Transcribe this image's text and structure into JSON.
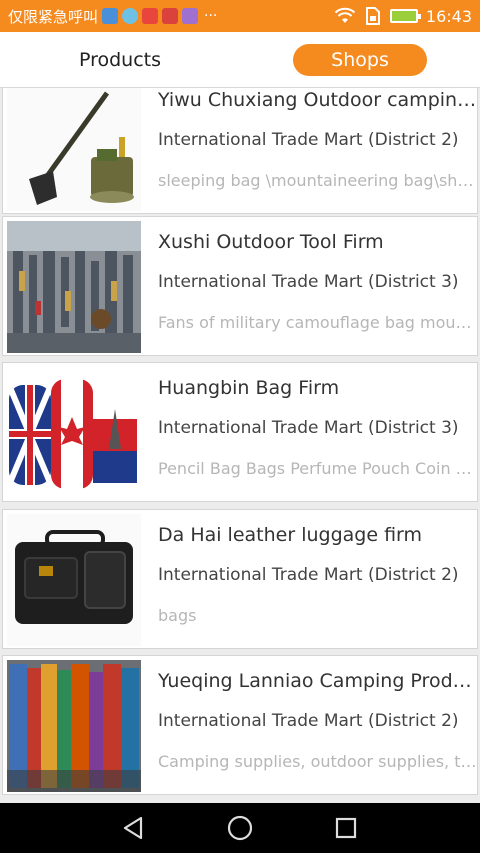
{
  "status_bar": {
    "carrier": "仅限紧急呼叫",
    "overflow": "···",
    "time": "16:43"
  },
  "tabs": {
    "products": "Products",
    "shops": "Shops",
    "active": "Shops"
  },
  "shops": [
    {
      "name": "Yiwu Chuxiang Outdoor camping supplies",
      "market": "International Trade Mart (District 2)",
      "description": "sleeping bag \\mountaineering bag\\shovel"
    },
    {
      "name": "Xushi Outdoor Tool Firm",
      "market": "International Trade Mart (District 3)",
      "description": "Fans of military camouflage bag mountaineering"
    },
    {
      "name": "Huangbin Bag Firm",
      "market": "International Trade Mart (District 3)",
      "description": "Pencil Bag Bags Perfume Pouch Coin Purse"
    },
    {
      "name": "Da Hai leather luggage firm",
      "market": "International Trade Mart (District 2)",
      "description": "bags"
    },
    {
      "name": "Yueqing Lanniao Camping Products",
      "market": "International Trade Mart (District 2)",
      "description": "Camping supplies, outdoor supplies, tents"
    }
  ],
  "colors": {
    "accent": "#f58a1f",
    "background": "#ececec"
  },
  "nav": {
    "back_icon": "back-triangle-icon",
    "home_icon": "home-circle-icon",
    "recents_icon": "recents-square-icon"
  }
}
